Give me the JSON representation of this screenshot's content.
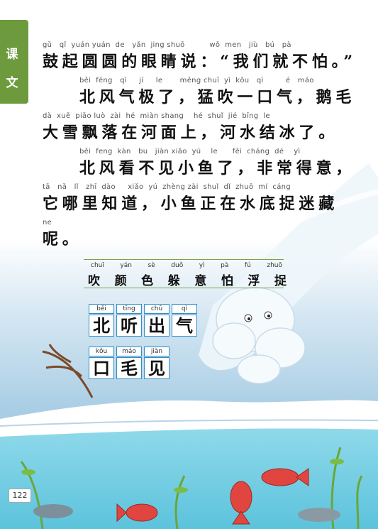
{
  "section_tab": [
    "课",
    "文"
  ],
  "text_lines": [
    {
      "pinyin": "gǔ   qǐ  yuán yuán  de   yǎn  jing shuō          wǒ  men   jiù   bú   pà",
      "hanzi": "鼓起圆圆的眼睛说：“我们就不怕。”"
    },
    {
      "pinyin": "běi  fēng   qì     jí     le       měng chuī  yì  kǒu   qì         é   máo",
      "hanzi": "北风气极了，猛吹一口气，鹅毛"
    },
    {
      "pinyin": "dà  xuě  piāo luò  zài  hé  miàn shang    hé  shuǐ  jié  bīng  le",
      "hanzi": "大雪飘落在河面上，河水结冰了。"
    },
    {
      "pinyin": "běi  feng  kàn   bu   jiàn xiǎo  yú    le      fēi  cháng  dé    yì",
      "hanzi": "北风看不见小鱼了，非常得意，"
    },
    {
      "pinyin": "tā   nǎ   lǐ   zhī  dào     xiǎo  yú  zhèng zài  shuǐ  dǐ  zhuō  mí  cáng",
      "hanzi": "它哪里知道，小鱼正在水底捉迷藏"
    },
    {
      "pinyin": "ne",
      "hanzi": "呢。"
    }
  ],
  "vocab_words": [
    {
      "pinyin": "chuī",
      "hanzi": "吹"
    },
    {
      "pinyin": "yán",
      "hanzi": "颜"
    },
    {
      "pinyin": "sè",
      "hanzi": "色"
    },
    {
      "pinyin": "duǒ",
      "hanzi": "躲"
    },
    {
      "pinyin": "yì",
      "hanzi": "意"
    },
    {
      "pinyin": "pà",
      "hanzi": "怕"
    },
    {
      "pinyin": "fú",
      "hanzi": "浮"
    },
    {
      "pinyin": "zhuō",
      "hanzi": "捉"
    }
  ],
  "writing_chars_row1": [
    {
      "pinyin": "běi",
      "hanzi": "北"
    },
    {
      "pinyin": "tīng",
      "hanzi": "听"
    },
    {
      "pinyin": "chū",
      "hanzi": "出"
    },
    {
      "pinyin": "qì",
      "hanzi": "气"
    }
  ],
  "writing_chars_row2": [
    {
      "pinyin": "kǒu",
      "hanzi": "口"
    },
    {
      "pinyin": "máo",
      "hanzi": "毛"
    },
    {
      "pinyin": "jiàn",
      "hanzi": "见"
    }
  ],
  "page_number": "122",
  "colors": {
    "tab": "#6d9a3c",
    "grid": "#2f8ec8",
    "water": "#7fd3e6"
  }
}
